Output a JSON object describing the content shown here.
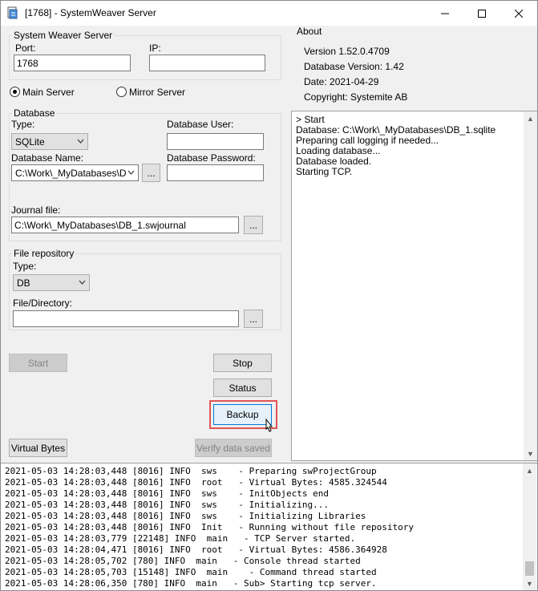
{
  "window": {
    "title": "[1768] - SystemWeaver Server"
  },
  "server_group": {
    "legend": "System Weaver Server",
    "port_label": "Port:",
    "port_value": "1768",
    "ip_label": "IP:",
    "ip_value": ""
  },
  "mode": {
    "main_label": "Main Server",
    "mirror_label": "Mirror Server",
    "selected": "main"
  },
  "database": {
    "legend": "Database",
    "type_label": "Type:",
    "type_value": "SQLite",
    "user_label": "Database User:",
    "user_value": "",
    "name_label": "Database Name:",
    "name_value": "C:\\Work\\_MyDatabases\\DE",
    "password_label": "Database Password:",
    "password_value": "",
    "browse_label": "...",
    "journal_label": "Journal file:",
    "journal_value": "C:\\Work\\_MyDatabases\\DB_1.swjournal",
    "journal_browse_label": "..."
  },
  "file_repository": {
    "legend": "File repository",
    "type_label": "Type:",
    "type_value": "DB",
    "dir_label": "File/Directory:",
    "dir_value": "",
    "browse_label": "..."
  },
  "buttons": {
    "start": "Start",
    "stop": "Stop",
    "status": "Status",
    "backup": "Backup",
    "virtual_bytes": "Virtual Bytes",
    "verify": "Verify data saved"
  },
  "about": {
    "legend": "About",
    "version": "Version 1.52.0.4709",
    "db_version": "Database Version: 1.42",
    "date": "Date: 2021-04-29",
    "copyright": "Copyright: Systemite AB"
  },
  "status_log": [
    "> Start",
    "Database: C:\\Work\\_MyDatabases\\DB_1.sqlite",
    "Preparing call logging if needed...",
    "Loading database...",
    "Database loaded.",
    "Starting TCP."
  ],
  "console_log": [
    "2021-05-03 14:28:03,448 [8016] INFO  sws    - Preparing swProjectGroup",
    "2021-05-03 14:28:03,448 [8016] INFO  root   - Virtual Bytes: 4585.324544",
    "2021-05-03 14:28:03,448 [8016] INFO  sws    - InitObjects end",
    "2021-05-03 14:28:03,448 [8016] INFO  sws    - Initializing...",
    "2021-05-03 14:28:03,448 [8016] INFO  sws    - Initializing Libraries",
    "2021-05-03 14:28:03,448 [8016] INFO  Init   - Running without file repository",
    "2021-05-03 14:28:03,779 [22148] INFO  main   - TCP Server started.",
    "2021-05-03 14:28:04,471 [8016] INFO  root   - Virtual Bytes: 4586.364928",
    "2021-05-03 14:28:05,702 [780] INFO  main   - Console thread started",
    "2021-05-03 14:28:05,703 [15148] INFO  main    - Command thread started",
    "2021-05-03 14:28:06,350 [780] INFO  main   - Sub> Starting tcp server."
  ],
  "icons": {
    "app": "app-icon",
    "minimize": "minimize-icon",
    "maximize": "maximize-icon",
    "close": "close-icon",
    "cursor": "mouse-pointer-icon"
  },
  "colors": {
    "highlight": "#e05555",
    "backup_border": "#0078d7"
  }
}
